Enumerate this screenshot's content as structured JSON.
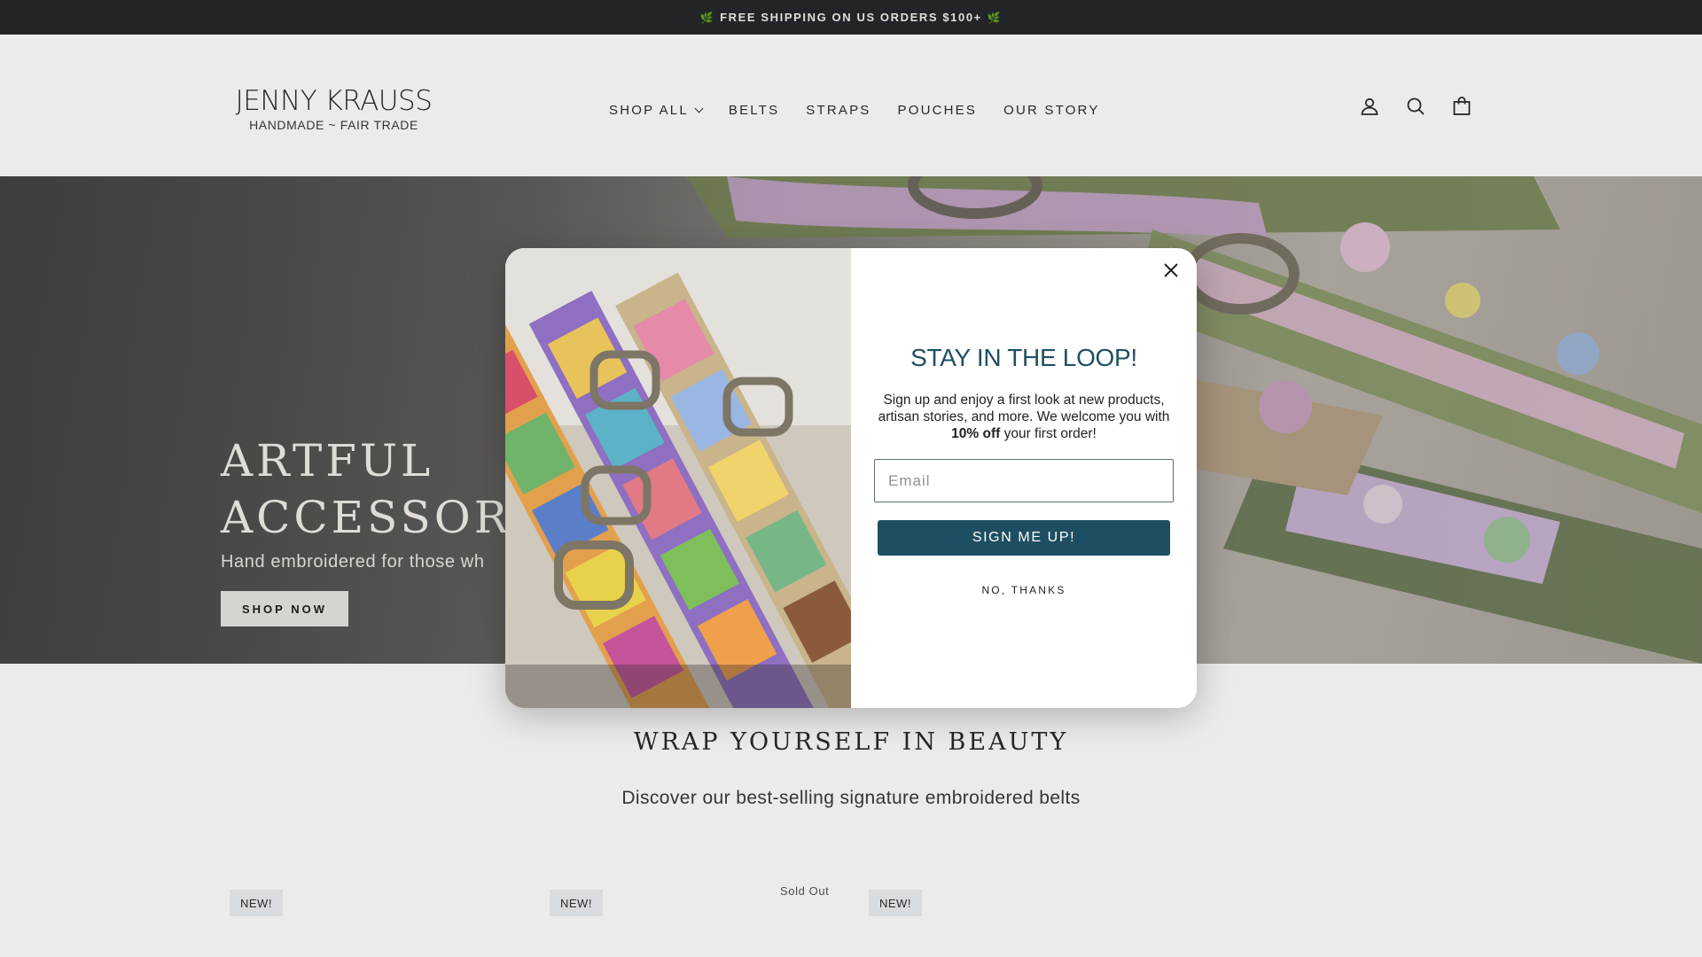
{
  "announcement": {
    "text": "FREE SHIPPING ON US ORDERS $100+",
    "leaf": "🌿"
  },
  "header": {
    "logo_name": "JENNY KRAUSS",
    "logo_tagline": "HANDMADE ~ FAIR TRADE",
    "nav": {
      "shop_all": "SHOP ALL",
      "belts": "BELTS",
      "straps": "STRAPS",
      "pouches": "POUCHES",
      "our_story": "OUR STORY"
    },
    "icons": [
      "account-icon",
      "search-icon",
      "cart-icon"
    ]
  },
  "hero": {
    "title_line1": "ARTFUL",
    "title_line2": "ACCESSORIES",
    "subtitle": "Hand embroidered for those wh",
    "button": "SHOP NOW"
  },
  "section": {
    "title": "WRAP YOURSELF IN BEAUTY",
    "subtitle": "Discover our best-selling signature embroidered belts",
    "badges": [
      "NEW!",
      "NEW!",
      "NEW!"
    ],
    "sold_out": "Sold Out"
  },
  "modal": {
    "title": "STAY IN THE LOOP!",
    "text_before": "Sign up and enjoy a first look at new products, artisan stories, and more. We welcome you with ",
    "text_bold": "10% off",
    "text_after": " your first order!",
    "email_placeholder": "Email",
    "submit": "SIGN ME UP!",
    "decline": "NO, THANKS"
  },
  "colors": {
    "announcement_bg": "#24292b",
    "modal_accent": "#1e4e61",
    "modal_title": "#1f4f63"
  }
}
